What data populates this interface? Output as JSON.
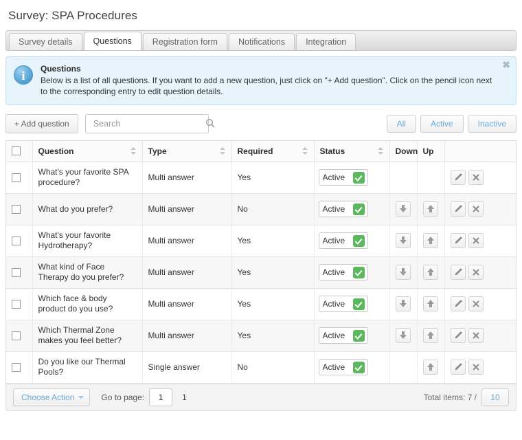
{
  "page_title": "Survey: SPA Procedures",
  "tabs": [
    {
      "label": "Survey details",
      "active": false
    },
    {
      "label": "Questions",
      "active": true
    },
    {
      "label": "Registration form",
      "active": false
    },
    {
      "label": "Notifications",
      "active": false
    },
    {
      "label": "Integration",
      "active": false
    }
  ],
  "info_banner": {
    "title": "Questions",
    "body": "Below is a list of all questions. If you want to add a new question, just click on \"+ Add question\". Click on the pencil icon next to the corresponding entry to edit question details.",
    "close_label": "✖"
  },
  "toolbar": {
    "add_question_label": "+ Add question",
    "search_placeholder": "Search",
    "search_value": "",
    "filters": [
      {
        "label": "All"
      },
      {
        "label": "Active"
      },
      {
        "label": "Inactive"
      }
    ]
  },
  "table": {
    "columns": [
      {
        "label": "",
        "sortable": false
      },
      {
        "label": "Question",
        "sortable": true
      },
      {
        "label": "Type",
        "sortable": true
      },
      {
        "label": "Required",
        "sortable": true
      },
      {
        "label": "Status",
        "sortable": true
      },
      {
        "label": "Down",
        "sortable": false
      },
      {
        "label": "Up",
        "sortable": false
      },
      {
        "label": "",
        "sortable": false
      }
    ],
    "rows": [
      {
        "question": "What's your favorite SPA procedure?",
        "type": "Multi answer",
        "required": "Yes",
        "status": "Active",
        "down": false,
        "up": false
      },
      {
        "question": "What do you prefer?",
        "type": "Multi answer",
        "required": "No",
        "status": "Active",
        "down": true,
        "up": true
      },
      {
        "question": "What's your favorite Hydrotherapy?",
        "type": "Multi answer",
        "required": "Yes",
        "status": "Active",
        "down": true,
        "up": true
      },
      {
        "question": "What kind of Face Therapy do you prefer?",
        "type": "Multi answer",
        "required": "Yes",
        "status": "Active",
        "down": true,
        "up": true
      },
      {
        "question": "Which face & body product do you use?",
        "type": "Multi answer",
        "required": "Yes",
        "status": "Active",
        "down": true,
        "up": true
      },
      {
        "question": "Which Thermal Zone makes you feel better?",
        "type": "Multi answer",
        "required": "Yes",
        "status": "Active",
        "down": true,
        "up": true
      },
      {
        "question": "Do you like our Thermal Pools?",
        "type": "Single answer",
        "required": "No",
        "status": "Active",
        "down": false,
        "up": true
      }
    ]
  },
  "footer": {
    "choose_action_label": "Choose Action",
    "goto_label": "Go to page:",
    "page_value": "1",
    "page_count": "1",
    "total_label": "Total items: 7 /",
    "per_page": "10"
  },
  "colors": {
    "accent_link": "#6aa8d8",
    "status_green": "#5cb85c",
    "banner_bg": "#e8f4fb",
    "banner_border": "#bcdff1"
  }
}
